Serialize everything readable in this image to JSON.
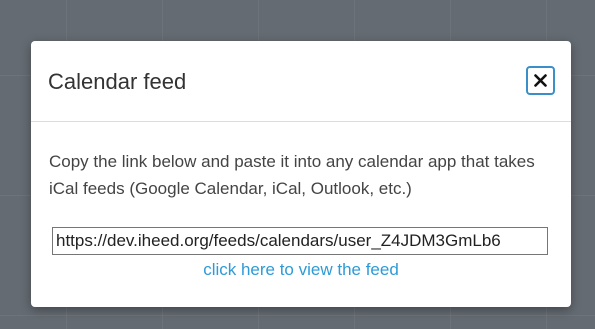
{
  "modal": {
    "title": "Calendar feed",
    "close_icon": "close-x-icon",
    "description": "Copy the link below and paste it into any calendar app that takes iCal feeds (Google Calendar, iCal, Outlook, etc.)",
    "feed_url": "https://dev.iheed.org/feeds/calendars/user_Z4JDM3GmLb6",
    "view_link_label": "click here to view the feed"
  },
  "colors": {
    "backdrop": "#646b72",
    "accent": "#3b8fc9",
    "link": "#2e9bd6"
  }
}
